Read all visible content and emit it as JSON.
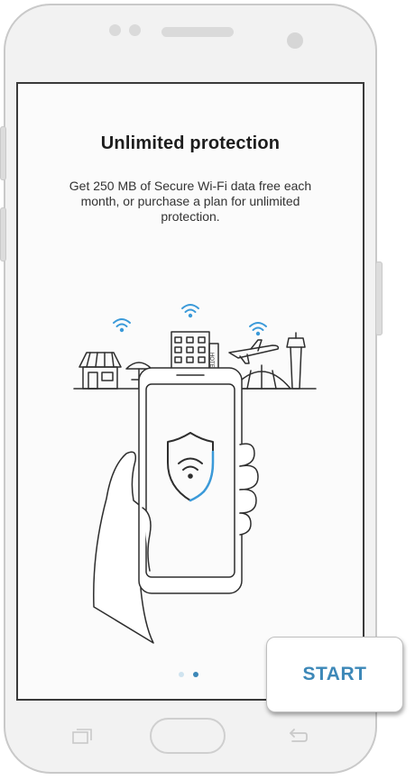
{
  "onboarding": {
    "title": "Unlimited protection",
    "description": "Get 250 MB of Secure Wi-Fi data free each month, or purchase a plan for unlimited protection.",
    "pager": {
      "total": 2,
      "active_index": 1
    },
    "hotel_sign": "HOTEL"
  },
  "start_button": {
    "label": "START"
  },
  "colors": {
    "accent": "#3d88b8",
    "wifi_blue": "#3b9ad9",
    "dot_inactive": "#cfe3ef",
    "dot_active": "#3d88b8",
    "line": "#2e2e2e"
  },
  "icons": {
    "shield": "shield-wifi-icon",
    "wifi": "wifi-icon",
    "recent_apps": "recent-apps-icon",
    "back": "back-icon"
  }
}
